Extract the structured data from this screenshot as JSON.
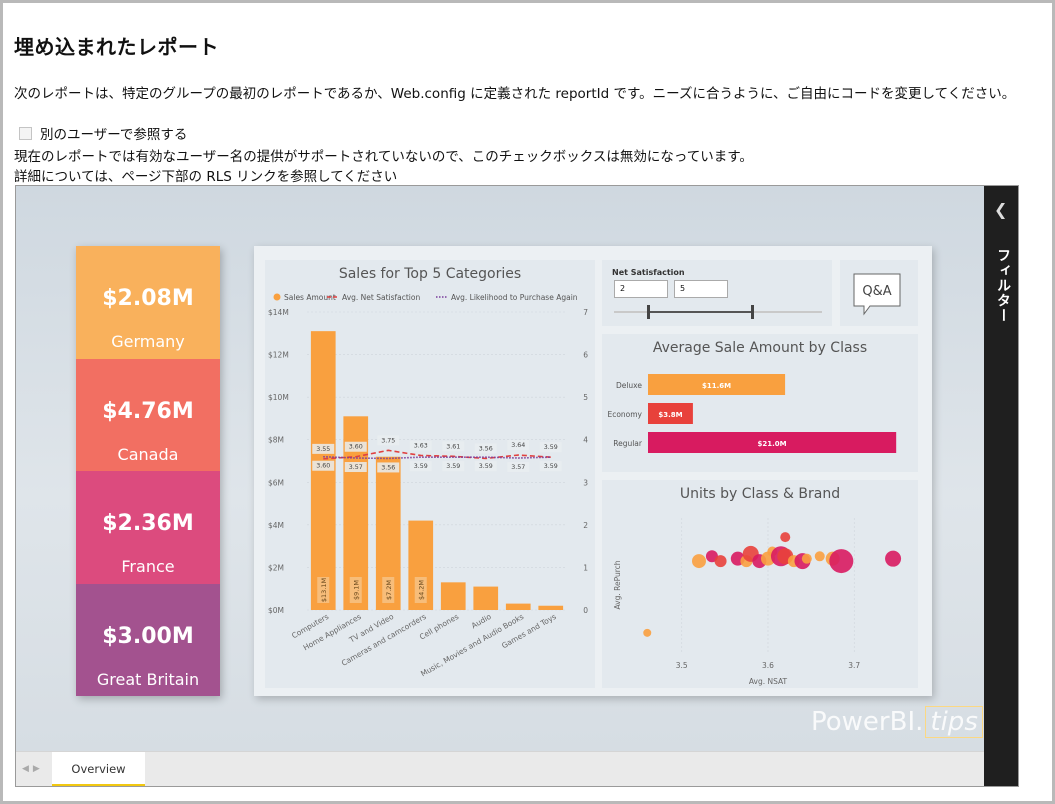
{
  "page": {
    "title": "埋め込まれたレポート",
    "description": "次のレポートは、特定のグループの最初のレポートであるか、Web.config に定義された reportId です。ニーズに合うように、ご自由にコードを変更してください。",
    "checkbox_label": "別のユーザーで参照する",
    "checkbox_checked": false,
    "note_line1": "現在のレポートでは有効なユーザー名の提供がサポートされていないので、このチェックボックスは無効になっています。",
    "note_line2": "詳細については、ページ下部の RLS リンクを参照してください"
  },
  "report": {
    "filter_pane_label": "フィルター",
    "tabs": [
      "Overview"
    ],
    "active_tab": "Overview",
    "watermark": {
      "text": "PowerBI.",
      "tips": "tips"
    },
    "kpis": [
      {
        "value": "$2.08M",
        "label": "Germany",
        "color": "#f9b15c"
      },
      {
        "value": "$4.76M",
        "label": "Canada",
        "color": "#f26f62"
      },
      {
        "value": "$2.36M",
        "label": "France",
        "color": "#dc4b7e"
      },
      {
        "value": "$3.00M",
        "label": "Great Britain",
        "color": "#a3528f"
      }
    ],
    "slicer": {
      "title": "Net Satisfaction",
      "min": "2",
      "max": "5"
    },
    "qa_label": "Q&A"
  },
  "chart_data": [
    {
      "type": "bar",
      "title": "Sales for Top 5 Categories",
      "categories": [
        "Computers",
        "Home Appliances",
        "TV and Video",
        "Cameras and camcorders",
        "Cell phones",
        "Audio",
        "Music, Movies and Audio Books",
        "Games and Toys"
      ],
      "series": [
        {
          "name": "Sales Amount",
          "axis": "left",
          "values": [
            13.1,
            9.1,
            7.2,
            4.2,
            1.3,
            1.1,
            0.3,
            0.2
          ],
          "color": "#f9a03f"
        },
        {
          "name": "Avg. Net Satisfaction",
          "axis": "right",
          "values": [
            3.55,
            3.6,
            3.75,
            3.63,
            3.61,
            3.56,
            3.64,
            3.59
          ],
          "color": "#e04040",
          "style": "dashed"
        },
        {
          "name": "Avg. Likelihood to Purchase Again",
          "axis": "right",
          "values": [
            3.6,
            3.57,
            3.56,
            3.59,
            3.59,
            3.59,
            3.57,
            3.59
          ],
          "color": "#7b3d9b",
          "style": "dotted"
        }
      ],
      "bar_labels": [
        "$13.1M",
        "$9.1M",
        "$7.2M",
        "$4.2M"
      ],
      "y_ticks": [
        "$0M",
        "$2M",
        "$4M",
        "$6M",
        "$8M",
        "$10M",
        "$12M",
        "$14M"
      ],
      "y2_ticks": [
        "0",
        "1",
        "2",
        "3",
        "4",
        "5",
        "6",
        "7"
      ],
      "ylim": [
        0,
        14
      ],
      "y2lim": [
        0,
        7
      ],
      "legend": "top-left"
    },
    {
      "type": "bar",
      "orientation": "horizontal",
      "title": "Average Sale Amount by Class",
      "categories": [
        "Deluxe",
        "Economy",
        "Regular"
      ],
      "values": [
        11.6,
        3.8,
        21.0
      ],
      "labels": [
        "$11.6M",
        "$3.8M",
        "$21.0M"
      ],
      "colors": [
        "#f9a03f",
        "#e8413b",
        "#d81b60"
      ],
      "xlim": [
        0,
        22
      ]
    },
    {
      "type": "scatter",
      "title": "Units by Class & Brand",
      "xlabel": "Avg. NSAT",
      "ylabel": "Avg. RePurch",
      "x_ticks": [
        "3.5",
        "3.6",
        "3.7"
      ],
      "xlim": [
        3.44,
        3.76
      ],
      "points": [
        {
          "x": 3.46,
          "y": 3.3,
          "r": 4,
          "c": "#f9a03f"
        },
        {
          "x": 3.52,
          "y": 3.6,
          "r": 7,
          "c": "#f9a03f"
        },
        {
          "x": 3.535,
          "y": 3.62,
          "r": 6,
          "c": "#d81b60"
        },
        {
          "x": 3.545,
          "y": 3.6,
          "r": 6,
          "c": "#e8413b"
        },
        {
          "x": 3.565,
          "y": 3.61,
          "r": 7,
          "c": "#d81b60"
        },
        {
          "x": 3.575,
          "y": 3.6,
          "r": 6,
          "c": "#f9a03f"
        },
        {
          "x": 3.58,
          "y": 3.63,
          "r": 8,
          "c": "#e8413b"
        },
        {
          "x": 3.59,
          "y": 3.6,
          "r": 7,
          "c": "#d81b60"
        },
        {
          "x": 3.6,
          "y": 3.61,
          "r": 7,
          "c": "#f9a03f"
        },
        {
          "x": 3.605,
          "y": 3.64,
          "r": 5,
          "c": "#f9a03f"
        },
        {
          "x": 3.615,
          "y": 3.62,
          "r": 10,
          "c": "#d81b60"
        },
        {
          "x": 3.62,
          "y": 3.62,
          "r": 8,
          "c": "#e8413b"
        },
        {
          "x": 3.63,
          "y": 3.6,
          "r": 6,
          "c": "#f9a03f"
        },
        {
          "x": 3.64,
          "y": 3.6,
          "r": 8,
          "c": "#d81b60"
        },
        {
          "x": 3.645,
          "y": 3.61,
          "r": 5,
          "c": "#f9a03f"
        },
        {
          "x": 3.66,
          "y": 3.62,
          "r": 5,
          "c": "#f9a03f"
        },
        {
          "x": 3.675,
          "y": 3.61,
          "r": 7,
          "c": "#f9a03f"
        },
        {
          "x": 3.685,
          "y": 3.6,
          "r": 12,
          "c": "#d81b60"
        },
        {
          "x": 3.62,
          "y": 3.7,
          "r": 5,
          "c": "#e8413b"
        },
        {
          "x": 3.745,
          "y": 3.61,
          "r": 8,
          "c": "#d81b60"
        }
      ]
    }
  ]
}
